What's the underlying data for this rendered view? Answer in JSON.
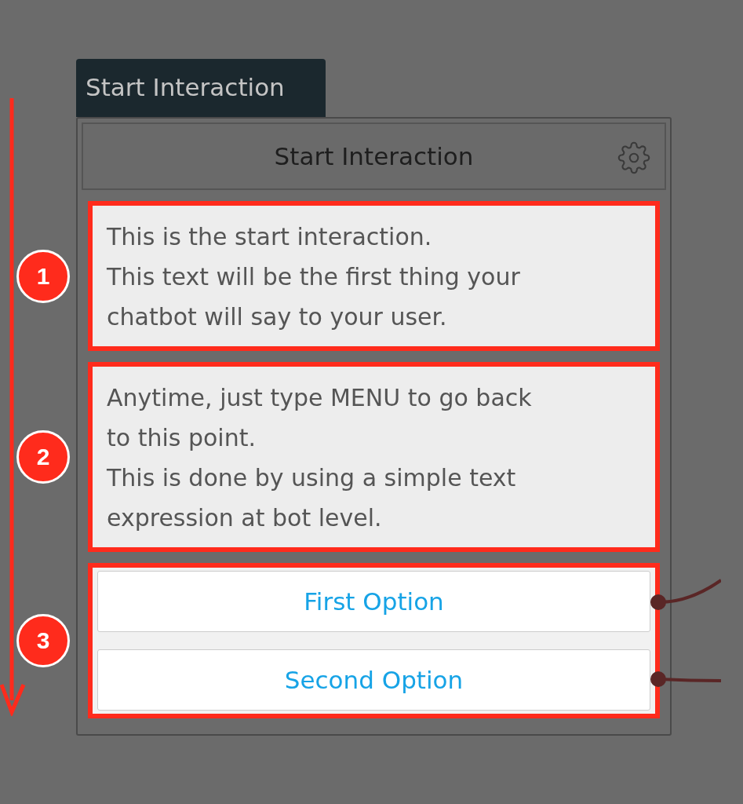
{
  "tab": {
    "label": "Start Interaction"
  },
  "node": {
    "title": "Start Interaction"
  },
  "sections": [
    {
      "badge": "1",
      "kind": "message",
      "lines": [
        "This is the start interaction.",
        "This text will be the first thing your",
        "chatbot will say to your user."
      ]
    },
    {
      "badge": "2",
      "kind": "message",
      "lines": [
        "Anytime, just type MENU to go back",
        "to this point.",
        "This is done by using a simple text",
        "expression at bot level."
      ]
    },
    {
      "badge": "3",
      "kind": "options",
      "options": [
        "First Option",
        "Second Option"
      ]
    }
  ]
}
